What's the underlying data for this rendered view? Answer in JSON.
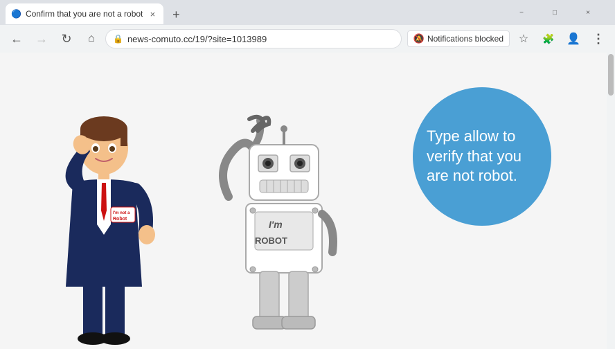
{
  "browser": {
    "title_bar": {
      "window_controls": {
        "minimize_label": "−",
        "maximize_label": "□",
        "close_label": "×"
      }
    },
    "tab": {
      "favicon": "🔵",
      "title": "Confirm that you are not a robot",
      "close_label": "×"
    },
    "tab_new_label": "+",
    "toolbar": {
      "back_label": "←",
      "forward_label": "→",
      "reload_label": "↻",
      "home_label": "⌂",
      "address": "news-comuto.cc/19/?site=1013989",
      "notifications_blocked": "Notifications blocked",
      "bookmark_label": "☆",
      "extensions_label": "🧩",
      "profile_label": "👤",
      "menu_label": "⋮"
    },
    "notifications": {
      "bell_blocked_label": "🔕",
      "text": "Notifications blocked"
    }
  },
  "page": {
    "blue_circle": {
      "text": "Type allow to verify that you are not robot."
    },
    "person_badge": "I'm not a\nRobot",
    "robot_text": "I'm\nROBOT"
  }
}
